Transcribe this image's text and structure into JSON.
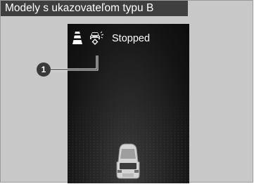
{
  "header": {
    "title": "Modely s ukazovateľom typu B"
  },
  "display": {
    "status_text": "Stopped",
    "icons": [
      "lane-marker-icon",
      "vehicle-ahead-icon",
      "vehicle-ahead-indicator-icon",
      "own-vehicle-icon"
    ]
  },
  "callout": {
    "number": "1"
  },
  "colors": {
    "title_bg": "#3f3f3f",
    "frame_bg": "#c8c8c8",
    "screen_bg": "#141414",
    "text_on_dark": "#ffffff"
  }
}
